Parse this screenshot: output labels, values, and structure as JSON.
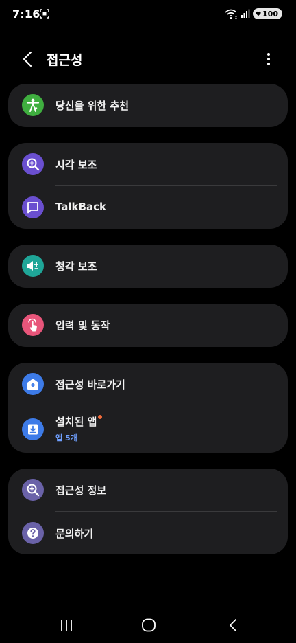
{
  "status_bar": {
    "time": "7:16",
    "battery": "100"
  },
  "header": {
    "title": "접근성"
  },
  "cards": [
    {
      "items": [
        {
          "label": "당신을 위한 추천",
          "icon": "accessibility-person-icon",
          "color": "#3fae3f"
        }
      ]
    },
    {
      "items": [
        {
          "label": "시각 보조",
          "icon": "magnifier-plus-icon",
          "color": "#6a4fd0"
        },
        {
          "label": "TalkBack",
          "icon": "speech-bubble-icon",
          "color": "#6a4fd0"
        }
      ]
    },
    {
      "items": [
        {
          "label": "청각 보조",
          "icon": "speaker-plus-icon",
          "color": "#1fa698"
        }
      ]
    },
    {
      "items": [
        {
          "label": "입력 및 동작",
          "icon": "touch-hand-icon",
          "color": "#e8557a"
        }
      ]
    },
    {
      "items": [
        {
          "label": "접근성 바로가기",
          "icon": "shortcut-plus-icon",
          "color": "#3d7be8"
        },
        {
          "label": "설치된 앱",
          "sublabel": "앱 5개",
          "icon": "download-box-icon",
          "color": "#3d7be8",
          "badge_color": "#f26b3a"
        }
      ]
    },
    {
      "items": [
        {
          "label": "접근성 정보",
          "icon": "info-magnifier-icon",
          "color": "#6a62a8"
        },
        {
          "label": "문의하기",
          "icon": "question-icon",
          "color": "#6a62a8"
        }
      ]
    }
  ],
  "nav_bar": {
    "recents": "recents-icon",
    "home": "home-icon",
    "back": "back-icon"
  }
}
